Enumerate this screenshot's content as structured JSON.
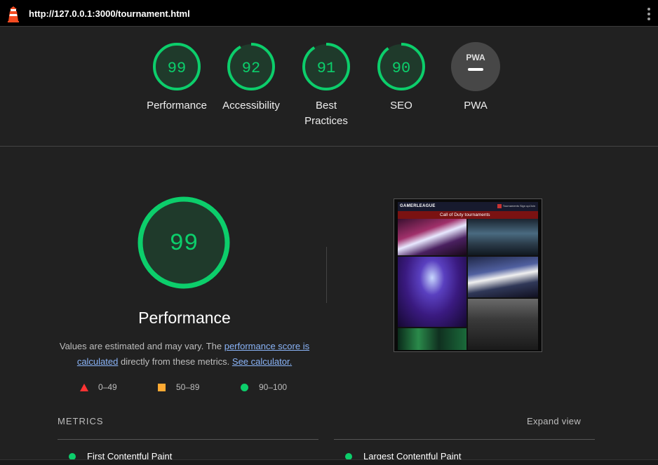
{
  "topbar": {
    "url": "http://127.0.0.1:3000/tournament.html"
  },
  "summary": {
    "categories": [
      {
        "label": "Performance",
        "score": "99"
      },
      {
        "label": "Accessibility",
        "score": "92"
      },
      {
        "label": "Best Practices",
        "score": "91"
      },
      {
        "label": "SEO",
        "score": "90"
      },
      {
        "label": "PWA",
        "badge_text": "PWA"
      }
    ]
  },
  "performance": {
    "score": "99",
    "title": "Performance",
    "desc_prefix": "Values are estimated and may vary. The ",
    "desc_link1": "performance score is calculated",
    "desc_middle": " directly from these metrics. ",
    "desc_link2": "See calculator.",
    "legend": [
      {
        "range": "0–49",
        "color": "#ff3333"
      },
      {
        "range": "50–89",
        "color": "#ffaa33"
      },
      {
        "range": "90–100",
        "color": "#0cce6b"
      }
    ]
  },
  "screenshot": {
    "brand": "GAMERLEAGUE",
    "links": "Tournaments   Sign up/Join",
    "heading": "Call of Duty tournaments"
  },
  "metrics": {
    "title": "METRICS",
    "expand_label": "Expand view",
    "items": [
      {
        "label": "First Contentful Paint"
      },
      {
        "label": "Largest Contentful Paint"
      }
    ]
  },
  "colors": {
    "pass": "#0cce6b",
    "pass_bg": "#1f3a2b",
    "bg": "#212121"
  }
}
